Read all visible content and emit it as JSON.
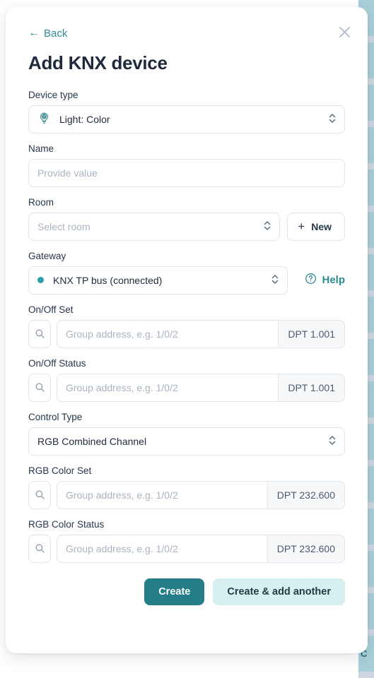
{
  "backdrop": {
    "list_letter": "C",
    "stripe_color": "#a9cfd9",
    "separator_color": "#ced7e0"
  },
  "modal": {
    "close_icon": "close-icon",
    "back_label": "Back",
    "back_arrow": "←",
    "title": "Add KNX device",
    "accent_color": "#2e8b96",
    "primary_button_color": "#247e87",
    "secondary_button_color": "#d6efef"
  },
  "fields": {
    "device_type": {
      "label": "Device type",
      "value": "Light: Color",
      "icon": "lightbulb-color-icon"
    },
    "name": {
      "label": "Name",
      "value": "",
      "placeholder": "Provide value"
    },
    "room": {
      "label": "Room",
      "value": "",
      "placeholder": "Select room",
      "new_button_label": "New",
      "new_button_icon": "plus-icon"
    },
    "gateway": {
      "label": "Gateway",
      "value": "KNX TP bus (connected)",
      "status_dot_color": "#2e9fa6",
      "help_label": "Help",
      "help_icon": "question-circle-icon"
    },
    "on_off_set": {
      "label": "On/Off Set",
      "value": "",
      "placeholder": "Group address, e.g. 1/0/2",
      "dpt": "DPT 1.001",
      "search_icon": "search-icon"
    },
    "on_off_status": {
      "label": "On/Off Status",
      "value": "",
      "placeholder": "Group address, e.g. 1/0/2",
      "dpt": "DPT 1.001",
      "search_icon": "search-icon"
    },
    "control_type": {
      "label": "Control Type",
      "value": "RGB Combined Channel"
    },
    "rgb_color_set": {
      "label": "RGB Color Set",
      "value": "",
      "placeholder": "Group address, e.g. 1/0/2",
      "dpt": "DPT 232.600",
      "search_icon": "search-icon"
    },
    "rgb_color_status": {
      "label": "RGB Color Status",
      "value": "",
      "placeholder": "Group address, e.g. 1/0/2",
      "dpt": "DPT 232.600",
      "search_icon": "search-icon"
    }
  },
  "actions": {
    "create_label": "Create",
    "create_add_another_label": "Create & add another"
  }
}
